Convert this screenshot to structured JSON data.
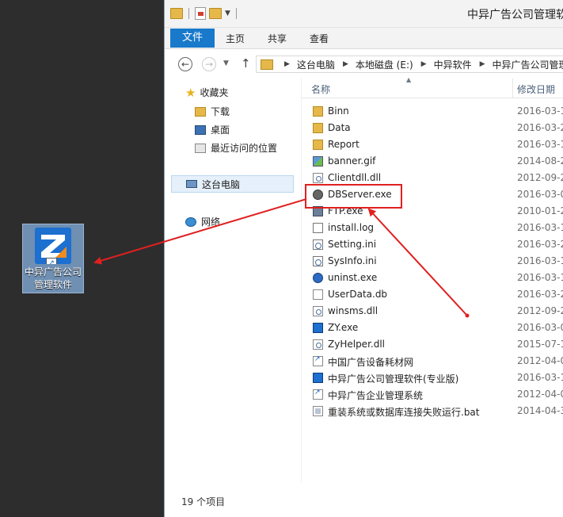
{
  "desktop": {
    "shortcut_label": "中异广告公司管理软件"
  },
  "window": {
    "title": "中异广告公司管理软件",
    "ribbon_tabs": [
      "文件",
      "主页",
      "共享",
      "查看"
    ],
    "address_crumbs": [
      "这台电脑",
      "本地磁盘 (E:)",
      "中异软件",
      "中异广告公司管理软件"
    ],
    "nav": {
      "favorites": "收藏夹",
      "downloads": "下载",
      "desktop": "桌面",
      "recent": "最近访问的位置",
      "this_pc": "这台电脑",
      "network": "网络"
    },
    "columns": {
      "name": "名称",
      "date": "修改日期"
    },
    "files": [
      {
        "name": "Binn",
        "date": "2016-03-1",
        "icon": "folder-icon"
      },
      {
        "name": "Data",
        "date": "2016-03-2",
        "icon": "folder-icon"
      },
      {
        "name": "Report",
        "date": "2016-03-1",
        "icon": "folder-icon"
      },
      {
        "name": "banner.gif",
        "date": "2014-08-2",
        "icon": "image-file-icon"
      },
      {
        "name": "Clientdll.dll",
        "date": "2012-09-2",
        "icon": "dll-file-icon"
      },
      {
        "name": "DBServer.exe",
        "date": "2016-03-0",
        "icon": "database-server-icon"
      },
      {
        "name": "FTP.exe",
        "date": "2010-01-2",
        "icon": "exe-file-icon"
      },
      {
        "name": "install.log",
        "date": "2016-03-1",
        "icon": "log-file-icon"
      },
      {
        "name": "Setting.ini",
        "date": "2016-03-2",
        "icon": "ini-file-icon"
      },
      {
        "name": "SysInfo.ini",
        "date": "2016-03-1",
        "icon": "ini-file-icon"
      },
      {
        "name": "uninst.exe",
        "date": "2016-03-1",
        "icon": "uninstall-icon"
      },
      {
        "name": "UserData.db",
        "date": "2016-03-2",
        "icon": "db-file-icon"
      },
      {
        "name": "winsms.dll",
        "date": "2012-09-2",
        "icon": "dll-file-icon"
      },
      {
        "name": "ZY.exe",
        "date": "2016-03-0",
        "icon": "zy-app-icon"
      },
      {
        "name": "ZyHelper.dll",
        "date": "2015-07-1",
        "icon": "dll-file-icon"
      },
      {
        "name": "中国广告设备耗材网",
        "date": "2012-04-0",
        "icon": "internet-shortcut-icon"
      },
      {
        "name": "中异广告公司管理软件(专业版)",
        "date": "2016-03-1",
        "icon": "zy-shortcut-icon"
      },
      {
        "name": "中异广告企业管理系统",
        "date": "2012-04-0",
        "icon": "internet-shortcut-icon"
      },
      {
        "name": "重装系统或数据库连接失败运行.bat",
        "date": "2014-04-3",
        "icon": "bat-file-icon"
      }
    ],
    "status": "19 个项目"
  },
  "colors": {
    "accent": "#1979ca",
    "annotation": "#e02020",
    "desktop_bg": "#2d2d2d"
  }
}
